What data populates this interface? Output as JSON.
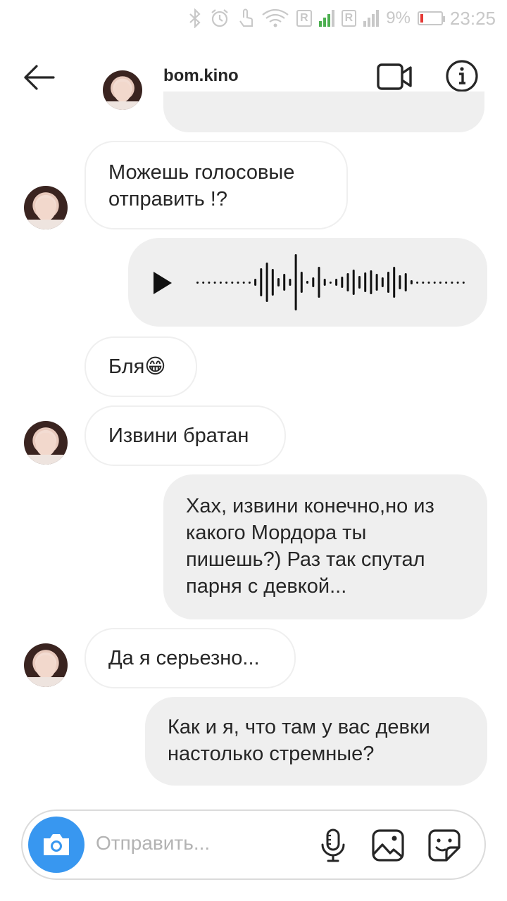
{
  "status_bar": {
    "signal_badge_1": "R",
    "signal_badge_2": "R",
    "battery_percent": "9%",
    "time": "23:25"
  },
  "header": {
    "username": "bom.kino"
  },
  "messages": [
    {
      "side": "in",
      "text_lines": [
        "Можешь голосовые",
        "отправить !?"
      ]
    },
    {
      "side": "out",
      "type": "voice"
    },
    {
      "side": "in",
      "text": "Бля😁"
    },
    {
      "side": "in",
      "text": "Извини братан"
    },
    {
      "side": "out",
      "text_lines": [
        "Хах, извини конечно,но из",
        "какого Мордора ты",
        "пишешь?) Раз так спутал",
        "парня с девкой..."
      ]
    },
    {
      "side": "in",
      "text": "Да я серьезно..."
    },
    {
      "side": "out",
      "text_lines": [
        "Как и я, что там у вас девки",
        "настолько стремные?"
      ]
    }
  ],
  "composer": {
    "placeholder": "Отправить..."
  },
  "colors": {
    "accent_blue": "#3897f0",
    "bubble_out": "#efefef",
    "bubble_in_border": "#efefef"
  }
}
